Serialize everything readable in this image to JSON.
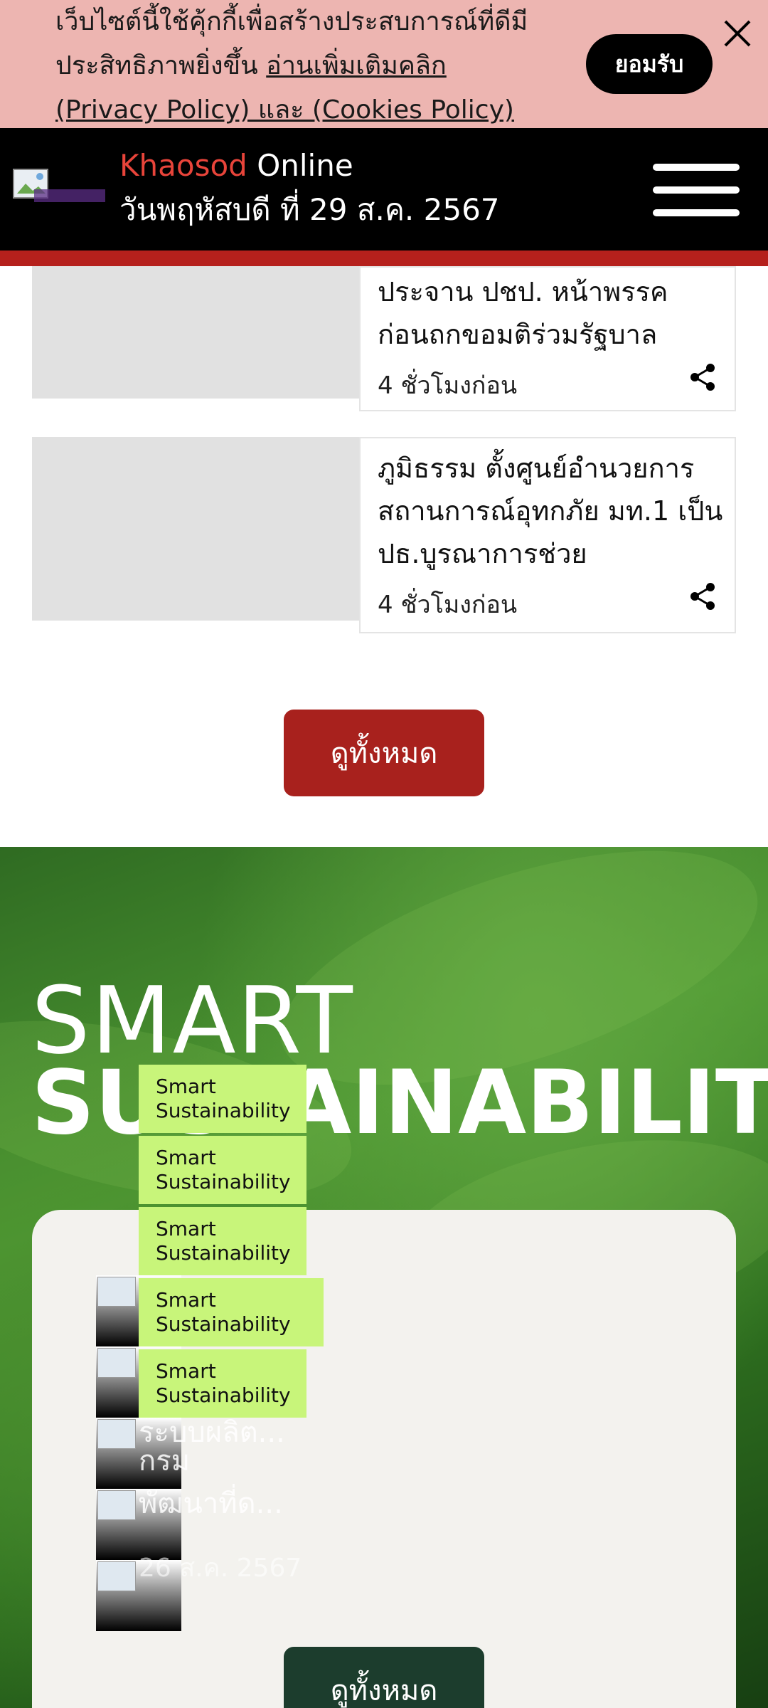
{
  "cookie_banner": {
    "line1": "เว็บไซต์นี้ใช้คุ้กกี้เพื่อสร้างประสบการณ์ที่ดีมี",
    "line2_prefix": "ประสิทธิภาพยิ่งขึ้น",
    "line2_link": "อ่านเพิ่มเติมคลิก",
    "line3_link": "(Privacy Policy) และ (Cookies Policy)",
    "accept_label": "ยอมรับ",
    "close_icon": "close-icon"
  },
  "header": {
    "brand_red": "Khaosod",
    "brand_white": "Online",
    "date": "วันพฤหัสบดี ที่ 29 ส.ค. 2567",
    "menu_icon": "hamburger-icon"
  },
  "news": [
    {
      "title": "ประจาน ปชป. หน้าพรรค ก่อนถกขอมติร่วมรัฐบาล",
      "time": "4 ชั่วโมงก่อน"
    },
    {
      "title": "ภูมิธรรม ตั้งศูนย์อำนวยการสถานการณ์อุทกภัย มท.1 เป็นปธ.บูรณาการช่วย",
      "time": "4 ชั่วโมงก่อน"
    }
  ],
  "view_all_label": "ดูทั้งหมด",
  "smart": {
    "title_line1": "SMART",
    "title_line2": "SUSTAINABILITY",
    "tags": [
      "Smart Sustainability",
      "Smart Sustainability",
      "Smart Sustainability",
      "Smart Sustainability",
      "Smart Sustainability"
    ],
    "ghost_text": [
      "ระบบผลิต...",
      "กรม",
      "พัฒนาที่ด...",
      "26 ส.ค. 2567"
    ],
    "view_all_label": "ดูทั้งหมด"
  },
  "colors": {
    "cookie_bg": "#edb5b1",
    "brand_red": "#e8443a",
    "header_stripe": "#b5201c",
    "view_all_red": "#a8211d",
    "tag_green": "#c8f57a",
    "view_all_green": "#1c3d2d"
  }
}
